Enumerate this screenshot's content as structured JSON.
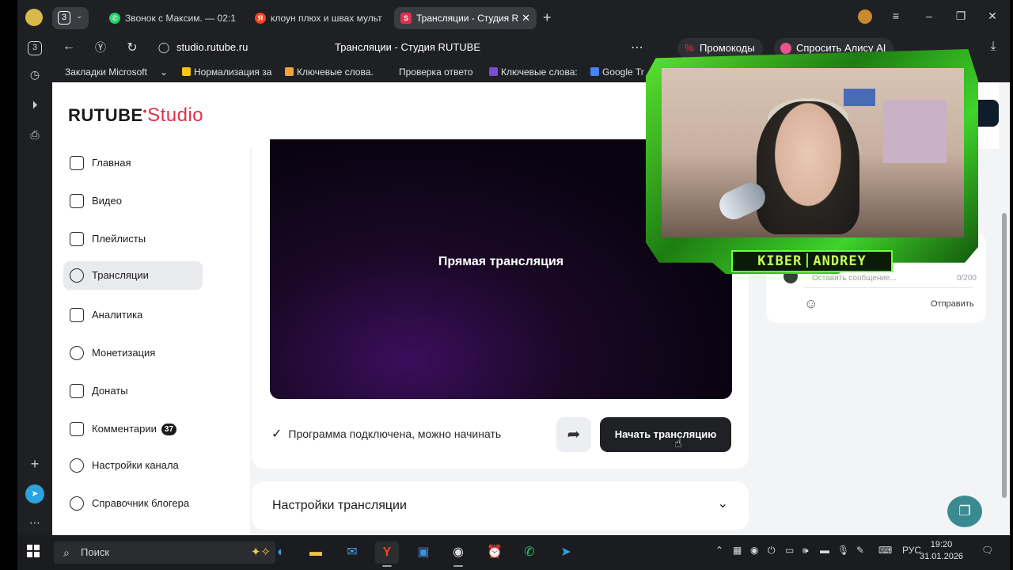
{
  "browser": {
    "tab_count": "3",
    "tabs": [
      {
        "label": "Звонок с Максим. — 02:1",
        "icon": "whatsapp-icon",
        "color": "#25d366"
      },
      {
        "label": "клоун плюх и швах мульт",
        "icon": "yandex-icon",
        "color": "#fc3f1d"
      },
      {
        "label": "Трансляции - Студия R",
        "icon": "rutube-icon",
        "color": "#e3304b"
      }
    ],
    "url": "studio.rutube.ru",
    "page_title": "Трансляции - Студия RUTUBE",
    "promo_label": "Промокоды",
    "alice_label": "Спросить Алису AI",
    "bookmarks": [
      "Закладки Microsoft",
      "Нормализация за",
      "Ключевые слова.",
      "Проверка ответо",
      "Ключевые слова:",
      "Google Tr"
    ]
  },
  "side_panel": {
    "badge": "3"
  },
  "logo": {
    "brand": "RUTUBE",
    "product": "Studio"
  },
  "sidebar": {
    "items": [
      {
        "label": "Главная",
        "icon": "home-icon"
      },
      {
        "label": "Видео",
        "icon": "video-icon"
      },
      {
        "label": "Плейлисты",
        "icon": "playlist-icon"
      },
      {
        "label": "Трансляции",
        "icon": "broadcast-icon",
        "active": true
      },
      {
        "label": "Аналитика",
        "icon": "analytics-icon"
      },
      {
        "label": "Монетизация",
        "icon": "ruble-icon"
      },
      {
        "label": "Донаты",
        "icon": "wallet-icon"
      },
      {
        "label": "Комментарии",
        "icon": "comment-icon",
        "badge": "37"
      },
      {
        "label": "Настройки канала",
        "icon": "gear-icon"
      },
      {
        "label": "Справочник блогера",
        "icon": "info-icon"
      }
    ]
  },
  "stream": {
    "video_title": "Прямая трансляция",
    "status": "Программа подключена, можно начинать",
    "start_button": "Начать трансляцию",
    "settings_title": "Настройки трансляции"
  },
  "chat": {
    "placeholder": "Оставить сообщение...",
    "counter": "0/200",
    "send": "Отправить"
  },
  "webcam": {
    "name_left": "KIBER",
    "name_right": "ANDREY"
  },
  "taskbar": {
    "search_placeholder": "Поиск",
    "lang": "РУС",
    "time": "19:20",
    "date": "31.01.2026"
  },
  "colors": {
    "accent": "#e3304b",
    "overlay_green": "#5ce632",
    "fab": "#3a8a92"
  }
}
